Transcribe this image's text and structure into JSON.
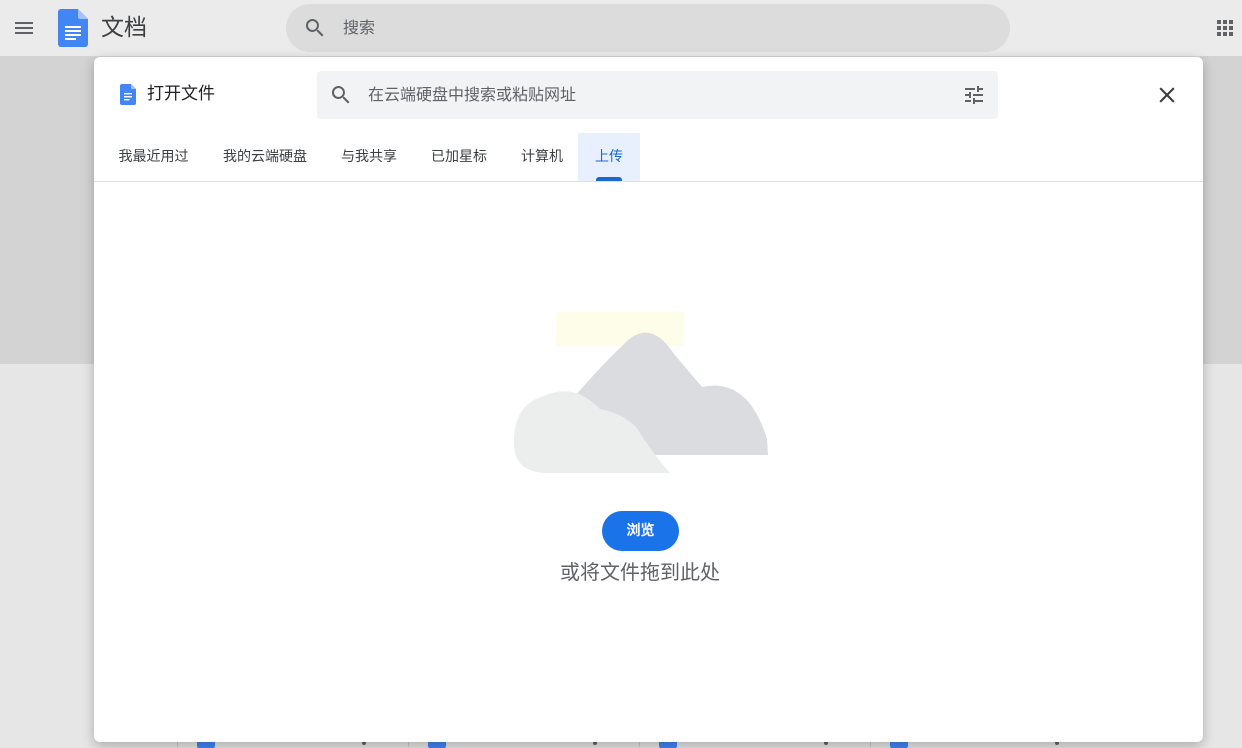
{
  "app": {
    "title": "文档",
    "search_placeholder": "搜索"
  },
  "dialog": {
    "title": "打开文件",
    "search_placeholder": "在云端硬盘中搜索或粘贴网址",
    "tabs": [
      {
        "label": "我最近用过",
        "active": false
      },
      {
        "label": "我的云端硬盘",
        "active": false
      },
      {
        "label": "与我共享",
        "active": false
      },
      {
        "label": "已加星标",
        "active": false
      },
      {
        "label": "计算机",
        "active": false
      },
      {
        "label": "上传",
        "active": true
      }
    ],
    "upload": {
      "browse_label": "浏览",
      "drop_hint": "或将文件拖到此处"
    }
  },
  "colors": {
    "accent": "#1a73e8",
    "active_tab_bg": "#e8f0fe",
    "docs_blue": "#4285f4"
  },
  "icons": {
    "menu": "hamburger-menu-icon",
    "search": "search-icon",
    "apps": "apps-grid-icon",
    "tune": "tune-sliders-icon",
    "close": "close-icon",
    "docs": "google-docs-icon"
  }
}
